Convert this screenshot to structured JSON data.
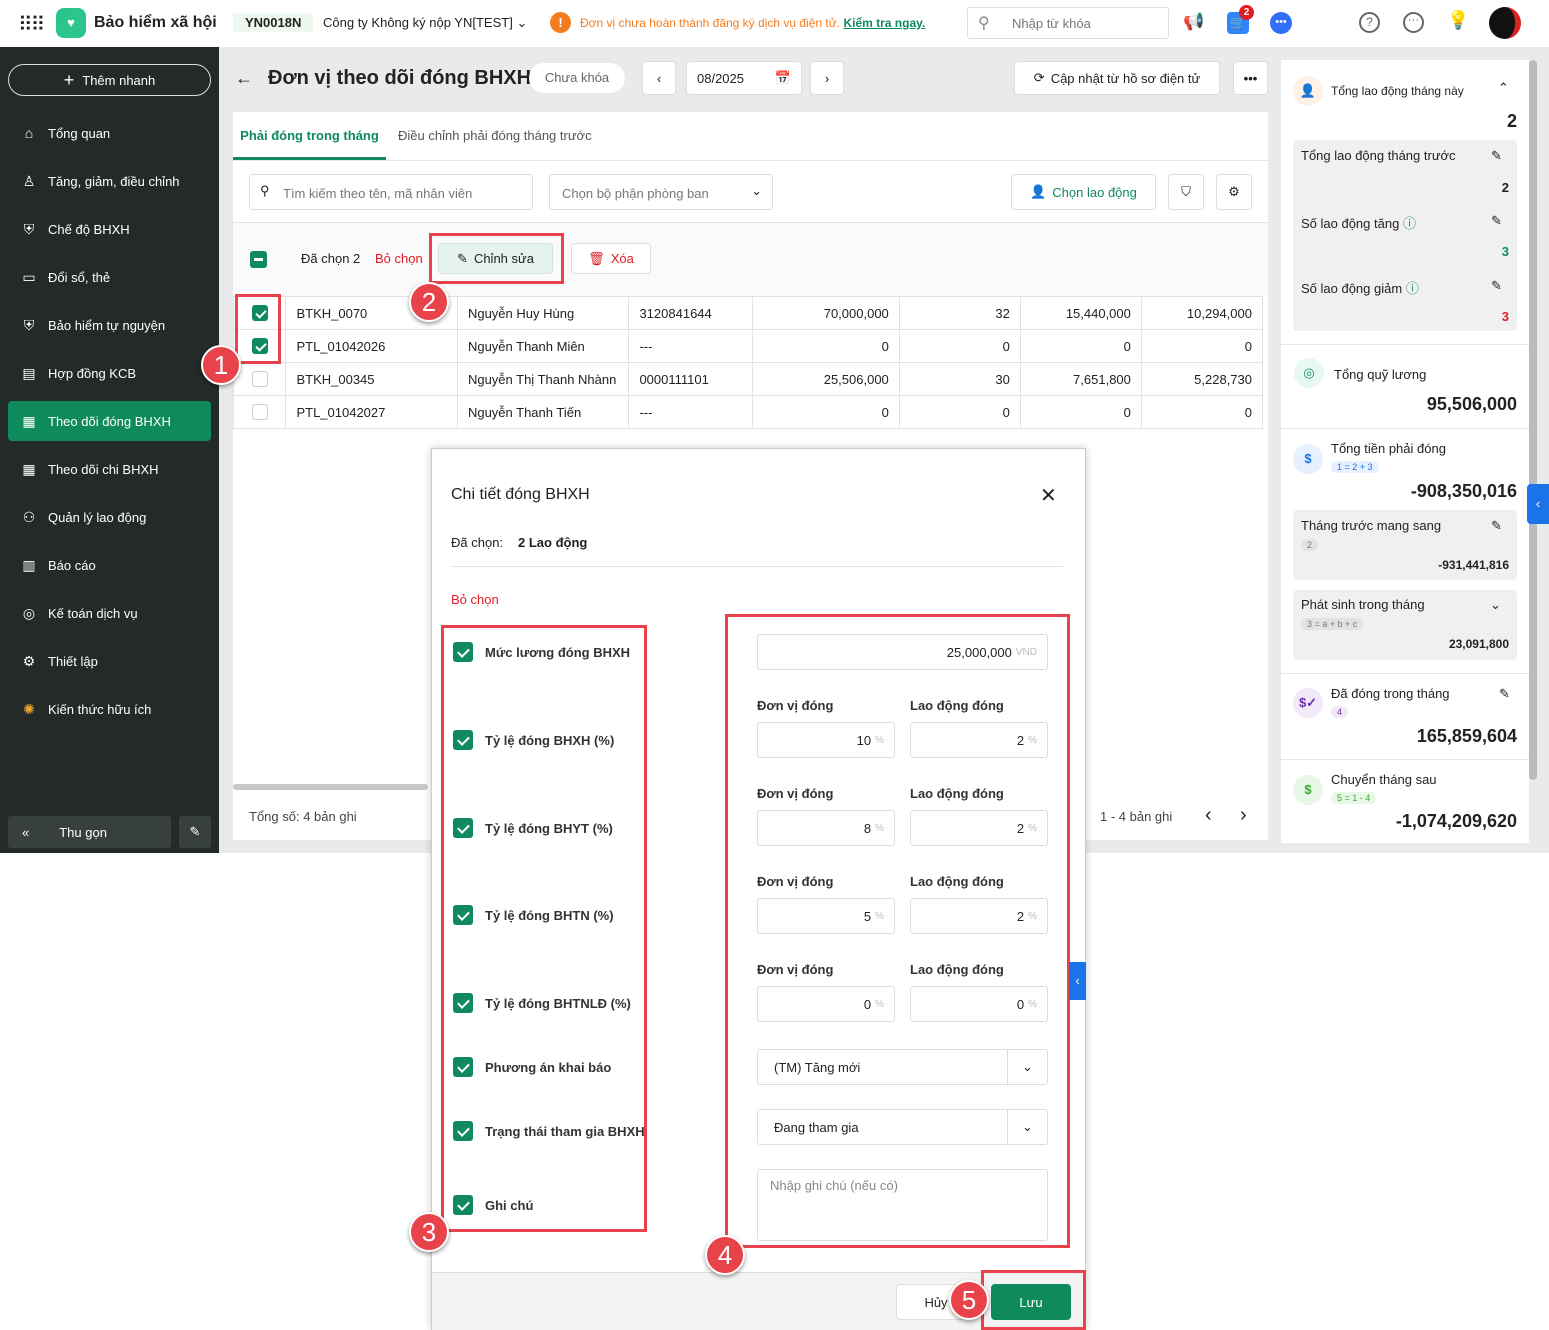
{
  "topbar": {
    "app_name": "Bảo hiểm xã hội",
    "company_code": "YN0018N",
    "company_name": "Công ty Không ký nộp YN[TEST]",
    "warning": "Đơn vị chưa hoàn thành đăng ký dịch vụ điện tử.",
    "warning_link": "Kiểm tra ngay.",
    "search_placeholder": "Nhập từ khóa",
    "cart_count": "2"
  },
  "sidebar": {
    "quick_add": "Thêm nhanh",
    "items": [
      {
        "label": "Tổng quan",
        "icon": "home-icon"
      },
      {
        "label": "Tăng, giảm, điều chỉnh",
        "icon": "user-icon"
      },
      {
        "label": "Chế độ BHXH",
        "icon": "shield-icon"
      },
      {
        "label": "Đổi sổ, thẻ",
        "icon": "card-icon"
      },
      {
        "label": "Bảo hiểm tự nguyện",
        "icon": "shield-check-icon"
      },
      {
        "label": "Hợp đồng KCB",
        "icon": "contract-icon"
      },
      {
        "label": "Theo dõi đóng BHXH",
        "icon": "doc-icon"
      },
      {
        "label": "Theo dõi chi BHXH",
        "icon": "doc-icon"
      },
      {
        "label": "Quản lý lao động",
        "icon": "users-icon"
      },
      {
        "label": "Báo cáo",
        "icon": "report-icon"
      },
      {
        "label": "Kế toán dịch vụ",
        "icon": "accounting-icon"
      },
      {
        "label": "Thiết lập",
        "icon": "gear-icon"
      },
      {
        "label": "Kiến thức hữu ích",
        "icon": "bulb-icon"
      }
    ],
    "collapse": "Thu gọn"
  },
  "header": {
    "title": "Đơn vị theo dõi đóng BHXH",
    "lock_status": "Chưa khóa",
    "period": "08/2025",
    "update_btn": "Cập nhật từ hồ sơ điện tử"
  },
  "tabs": [
    {
      "label": "Phải đóng trong tháng",
      "active": true
    },
    {
      "label": "Điều chỉnh phải đóng tháng trước",
      "active": false
    }
  ],
  "filters": {
    "search_placeholder": "Tìm kiếm theo tên, mã nhân viên",
    "dept_placeholder": "Chọn bộ phận phòng ban",
    "choose_employee": "Chọn lao động"
  },
  "selection": {
    "selected": "Đã chọn 2",
    "deselect": "Bỏ chọn",
    "edit": "Chỉnh sửa",
    "delete": "Xóa"
  },
  "rows": [
    {
      "checked": true,
      "code": "BTKH_0070",
      "name": "Nguyễn Huy Hùng",
      "id": "3120841644",
      "salary": "70,000,000",
      "c5": "32",
      "c6": "15,440,000",
      "c7": "10,294,000"
    },
    {
      "checked": true,
      "code": "PTL_01042026",
      "name": "Nguyễn Thanh Miên",
      "id": "---",
      "salary": "0",
      "c5": "0",
      "c6": "0",
      "c7": "0"
    },
    {
      "checked": false,
      "code": "BTKH_00345",
      "name": "Nguyễn Thị Thanh Nhànn",
      "id": "0000111101",
      "salary": "25,506,000",
      "c5": "30",
      "c6": "7,651,800",
      "c7": "5,228,730"
    },
    {
      "checked": false,
      "code": "PTL_01042027",
      "name": "Nguyễn Thanh Tiến",
      "id": "---",
      "salary": "0",
      "c5": "0",
      "c6": "0",
      "c7": "0"
    }
  ],
  "footer": {
    "total": "Tổng số: 4 bản ghi",
    "range": "1 - 4 bản ghi"
  },
  "right_panel": {
    "total_labor": "Tổng lao động tháng này",
    "total_labor_val": "2",
    "prev_labor": "Tổng lao động tháng trước",
    "prev_labor_val": "2",
    "inc": "Số lao động tăng",
    "inc_val": "3",
    "dec": "Số lao động giảm",
    "dec_val": "3",
    "payroll": "Tổng quỹ lương",
    "payroll_val": "95,506,000",
    "due": "Tổng tiền phải đóng",
    "due_tag": "1 = 2 + 3",
    "due_val": "-908,350,016",
    "carry": "Tháng trước mang sang",
    "carry_tag": "2",
    "carry_val": "-931,441,816",
    "arise": "Phát sinh trong tháng",
    "arise_tag": "3 = a + b + c",
    "arise_val": "23,091,800",
    "paid": "Đã đóng trong tháng",
    "paid_tag": "4",
    "paid_val": "165,859,604",
    "next": "Chuyển tháng sau",
    "next_tag": "5 = 1 - 4",
    "next_val": "-1,074,209,620"
  },
  "modal": {
    "title": "Chi tiết đóng BHXH",
    "selected_label": "Đã chọn:",
    "selected_value": "2 Lao động",
    "deselect": "Bỏ chọn",
    "fields": [
      "Mức lương đóng BHXH",
      "Tỷ lệ đóng BHXH (%)",
      "Tỷ lệ đóng BHYT (%)",
      "Tỷ lệ đóng BHTN (%)",
      "Tỷ lệ đóng BHTNLĐ (%)",
      "Phương án khai báo",
      "Trạng thái tham gia BHXH",
      "Ghi chú"
    ],
    "salary": "25,000,000",
    "salary_unit": "VND",
    "employer_label": "Đơn vị đóng",
    "employee_label": "Lao động đóng",
    "pct": "%",
    "rates": [
      {
        "employer": "10",
        "employee": "2"
      },
      {
        "employer": "8",
        "employee": "2"
      },
      {
        "employer": "5",
        "employee": "2"
      },
      {
        "employer": "0",
        "employee": "0"
      }
    ],
    "plan": "(TM) Tăng mới",
    "status": "Đang tham gia",
    "note_placeholder": "Nhập ghi chú (nếu có)",
    "cancel": "Hủy",
    "save": "Lưu"
  },
  "steps": [
    "1",
    "2",
    "3",
    "4",
    "5"
  ]
}
